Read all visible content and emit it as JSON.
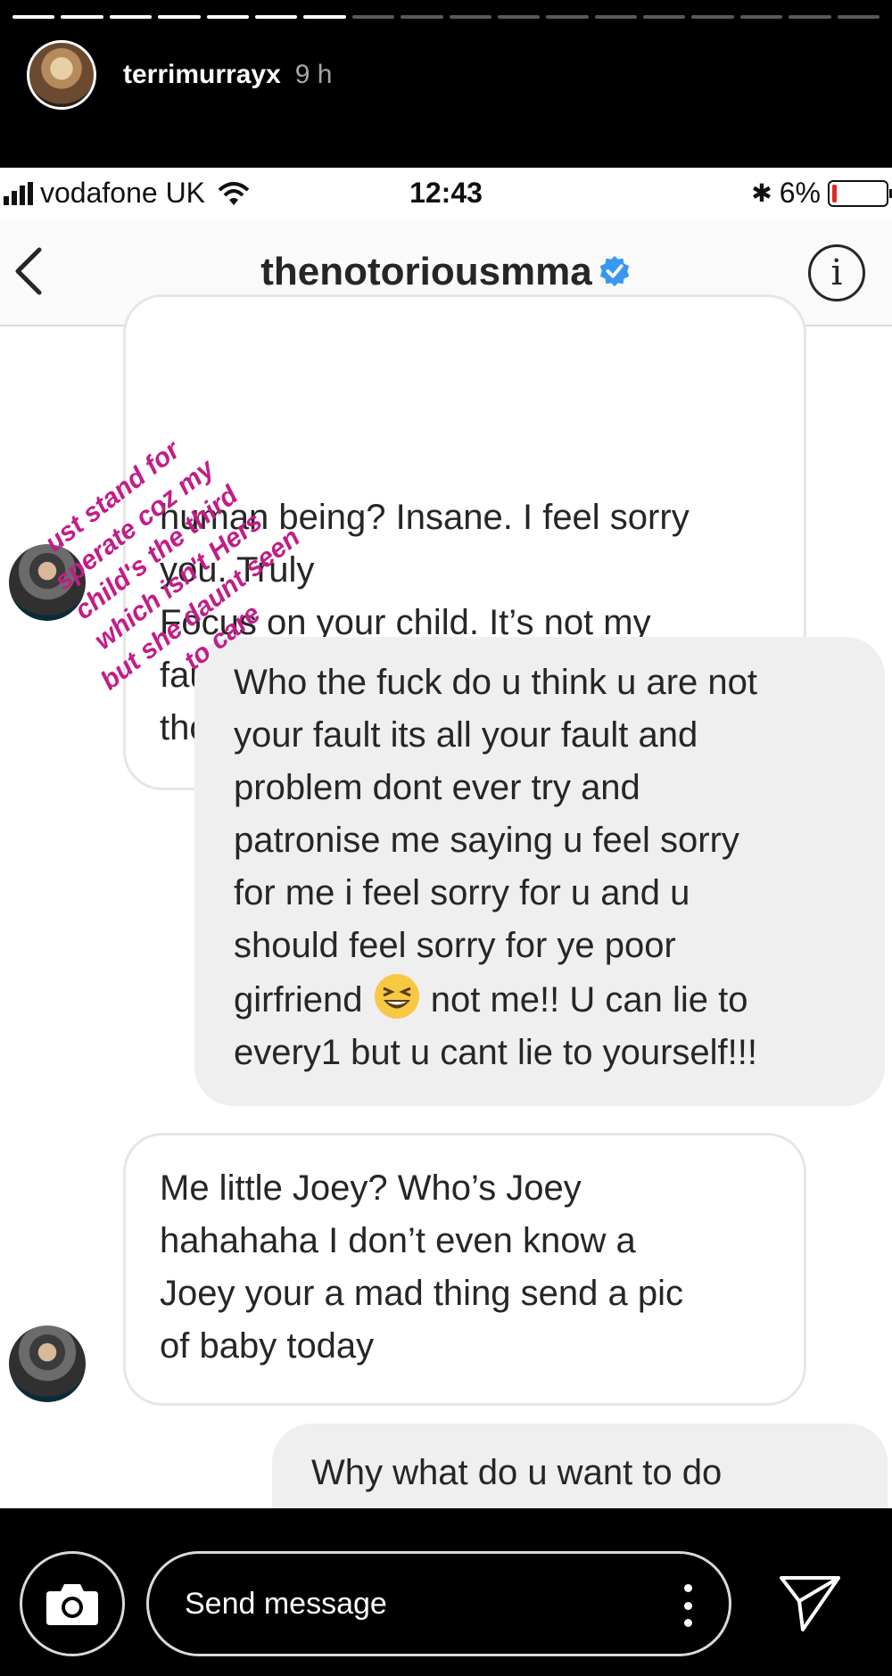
{
  "story": {
    "segments_total": 18,
    "segments_viewed": 7,
    "username": "terrimurrayx",
    "time": "9 h",
    "sticker_text": "ust stand for\nsperate coz my\nchild's the third\nwhich isn't Hers\nbut she daunt seen\nto care",
    "sticker_color": "#c21d89"
  },
  "screenshot": {
    "status": {
      "carrier": "vodafone UK",
      "time": "12:43",
      "battery": "6%",
      "battery_level": 0.06
    },
    "header": {
      "back_icon": "chevron-left-icon",
      "title": "thenotoriousmma",
      "verified_icon": "verified-badge-icon",
      "info_icon": "info-icon"
    },
    "messages": [
      {
        "direction": "in",
        "text": "human being? Insane. I feel sorry\nyou. Truly\nFocus on your child. It’s not my\nfault or my problem. But still love\ntho"
      },
      {
        "direction": "out",
        "text_part1": "Who the fuck do u think u are not\nyour fault its all your fault and\nproblem dont ever try and\npatronise me saying u feel sorry\nfor me i feel sorry for u and u\nshould feel sorry for ye poor\ngirfriend ",
        "emoji": "grinning-squinting-face-emoji",
        "text_part2": " not me!! U can lie to\nevery1 but u cant lie to yourself!!!"
      },
      {
        "direction": "in",
        "text": "Me little Joey? Who’s Joey\nhahahaha I don’t even know a\nJoey your a mad thing send a pic\nof baby today"
      },
      {
        "direction": "out",
        "text": "Why what do u want to do"
      }
    ]
  },
  "reply": {
    "placeholder": "Send message",
    "camera_icon": "camera-icon",
    "more_icon": "more-vertical-icon",
    "send_icon": "direct-send-icon"
  }
}
